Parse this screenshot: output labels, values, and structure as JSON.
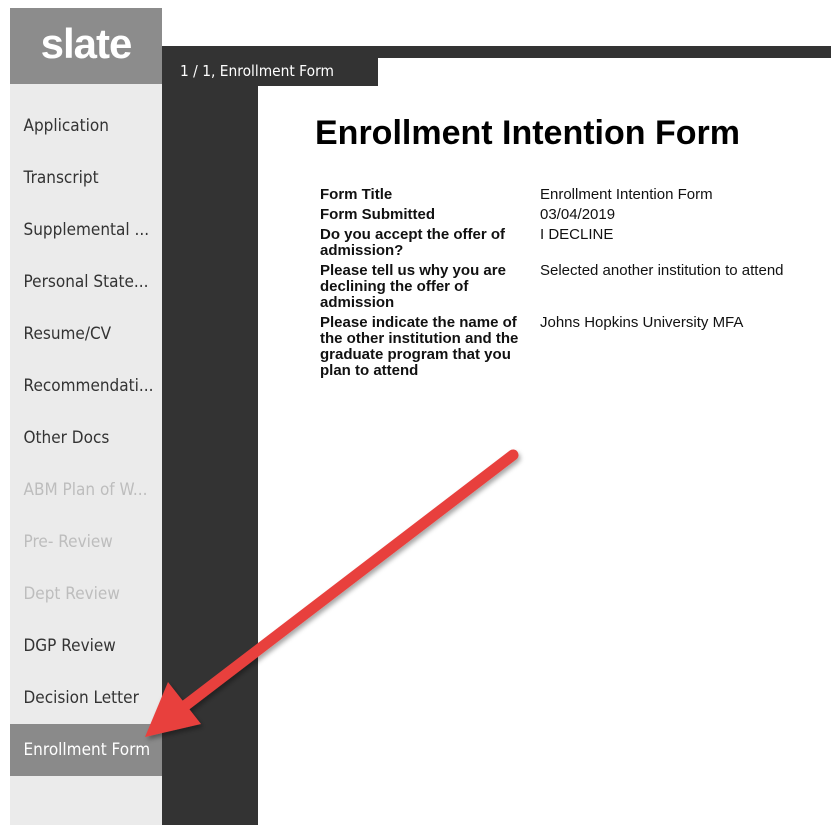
{
  "logo": "slate",
  "sidebar": {
    "items": [
      {
        "label": "Application"
      },
      {
        "label": "Transcript"
      },
      {
        "label": "Supplemental ..."
      },
      {
        "label": "Personal State..."
      },
      {
        "label": "Resume/CV"
      },
      {
        "label": "Recommendati..."
      },
      {
        "label": "Other Docs"
      },
      {
        "label": "ABM Plan of W..."
      },
      {
        "label": "Pre- Review"
      },
      {
        "label": "Dept Review"
      },
      {
        "label": "DGP Review"
      },
      {
        "label": "Decision Letter"
      },
      {
        "label": "Enrollment Form"
      }
    ]
  },
  "tab": {
    "label": "1 / 1, Enrollment Form"
  },
  "form": {
    "heading": "Enrollment Intention Form",
    "fields": [
      {
        "label": "Form Title",
        "value": "Enrollment Intention Form"
      },
      {
        "label": "Form Submitted",
        "value": "03/04/2019"
      },
      {
        "label": "Do you accept the offer of admission?",
        "value": "I DECLINE"
      },
      {
        "label": "Please tell us why you are declining the offer of admission",
        "value": "Selected another institution to attend"
      },
      {
        "label": "Please indicate the name of the other institution and the graduate program that you plan to attend",
        "value": "Johns Hopkins University MFA"
      }
    ]
  },
  "colors": {
    "arrow": "#e8413e",
    "sidebar_active": "#8a8a8a",
    "dark": "#333333"
  }
}
